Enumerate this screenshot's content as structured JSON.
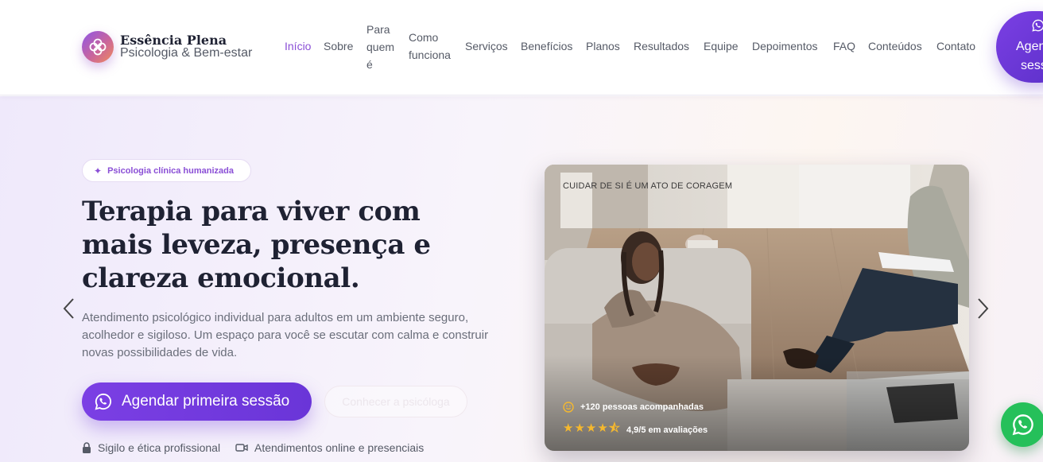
{
  "header": {
    "brand_name": "Essência Plena",
    "brand_tagline": "Psicologia & Bem-estar",
    "nav": [
      {
        "label": "Início",
        "active": true
      },
      {
        "label": "Sobre"
      },
      {
        "label": "Para quem é"
      },
      {
        "label": "Como funciona"
      },
      {
        "label": "Serviços"
      },
      {
        "label": "Benefícios"
      },
      {
        "label": "Planos"
      },
      {
        "label": "Resultados"
      },
      {
        "label": "Equipe"
      },
      {
        "label": "Depoimentos"
      },
      {
        "label": "FAQ"
      },
      {
        "label": "Conteúdos"
      },
      {
        "label": "Contato"
      }
    ],
    "cta_line1": "Agen",
    "cta_line2": "sess"
  },
  "hero": {
    "badge": "Psicologia clínica humanizada",
    "title": "Terapia para viver com mais leveza, presença e clareza emocional.",
    "description": "Atendimento psicológico individual para adultos em um ambiente seguro, acolhedor e sigiloso. Um espaço para você se escutar com calma e construir novas possibilidades de vida.",
    "primary_button": "Agendar primeira sessão",
    "secondary_button": "Conhecer a psicóloga",
    "trust": [
      {
        "icon": "lock-icon",
        "label": "Sigilo e ética profissional"
      },
      {
        "icon": "video-icon",
        "label": "Atendimentos online e presenciais"
      }
    ]
  },
  "photo_card": {
    "caption": "CUIDAR DE SI É UM ATO DE CORAGEM",
    "stat_people": "+120 pessoas acompanhadas",
    "rating": 4.5,
    "stat_rating": "4,9/5 em avaliações"
  },
  "colors": {
    "accent": "#7b3fe4",
    "whatsapp": "#25c05a",
    "star": "#f5b82e"
  }
}
